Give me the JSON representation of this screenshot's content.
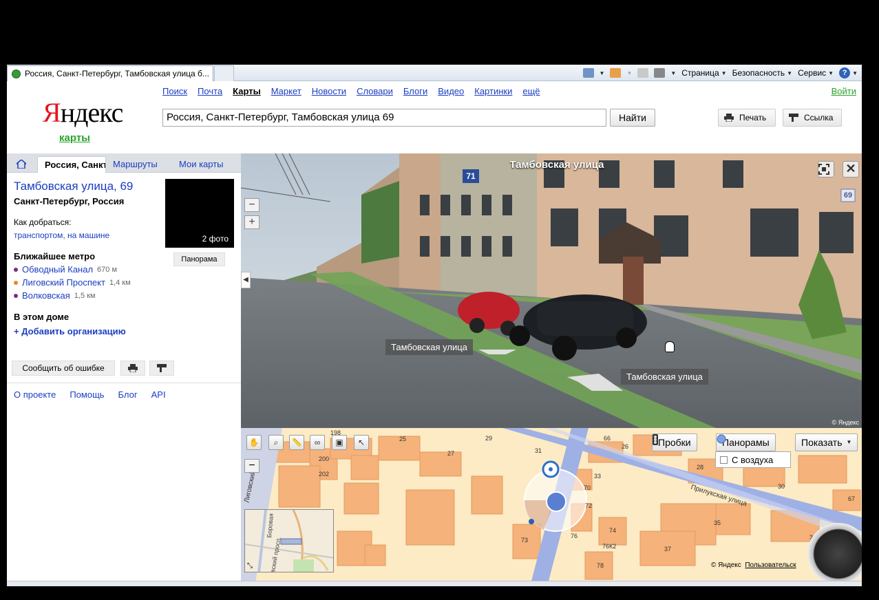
{
  "browser": {
    "tab_title": "Россия, Санкт-Петербург, Тамбовская улица б...",
    "menu_page": "Страница",
    "menu_security": "Безопасность",
    "menu_tools": "Сервис"
  },
  "header": {
    "logo_first": "Я",
    "logo_rest": "ндекс",
    "logo_sub": "карты",
    "services": [
      "Поиск",
      "Почта",
      "Карты",
      "Маркет",
      "Новости",
      "Словари",
      "Блоги",
      "Видео",
      "Картинки",
      "ещё"
    ],
    "login": "Войти",
    "search_value": "Россия, Санкт-Петербург, Тамбовская улица 69",
    "search_button": "Найти",
    "print_label": "Печать",
    "link_label": "Ссылка"
  },
  "left": {
    "tabs": [
      "Россия, Санкт",
      "Маршруты",
      "Мои карты"
    ],
    "title": "Тамбовская улица, 69",
    "subtitle": "Санкт-Петербург, Россия",
    "photo_count": "2 фото",
    "panorama_button": "Панорама",
    "directions_label": "Как добраться:",
    "directions_links": "транспортом, на машине",
    "metro_heading": "Ближайшее метро",
    "metro": [
      {
        "name": "Обводный Канал",
        "dist": "670 м",
        "color": "#7a2a8a"
      },
      {
        "name": "Лиговский Проспект",
        "dist": "1,4 км",
        "color": "#e8891e"
      },
      {
        "name": "Волковская",
        "dist": "1,5 км",
        "color": "#7a2a8a"
      }
    ],
    "house_heading": "В этом доме",
    "add_org": "+ Добавить организацию",
    "report_error": "Сообщить об ошибке",
    "footer": [
      "О проекте",
      "Помощь",
      "Блог",
      "API"
    ]
  },
  "panorama": {
    "title": "Тамбовская улица",
    "street_label_left": "Тамбовская улица",
    "street_label_right": "Тамбовская улица",
    "sign_71": "71",
    "sign_69": "69",
    "copyright": "© Яндекс"
  },
  "map": {
    "traffic_button": "Пробки",
    "panoramas_button": "Панорамы",
    "show_button": "Показать",
    "air_option": "С воздуха",
    "copyright": "© Яндекс",
    "user_link": "Пользовательск",
    "street_prilukskaya": "Прилукская улица",
    "street_ligovsky": "Лиговский",
    "minimap_borovaya": "Боровая",
    "minimap_ligovsky": "вский просп.",
    "buildings": [
      "198",
      "200",
      "202",
      "25",
      "27",
      "29",
      "31",
      "66",
      "26",
      "28",
      "30",
      "33",
      "35",
      "37",
      "39",
      "67",
      "70",
      "72",
      "74",
      "76",
      "76К2",
      "73",
      "78"
    ]
  }
}
